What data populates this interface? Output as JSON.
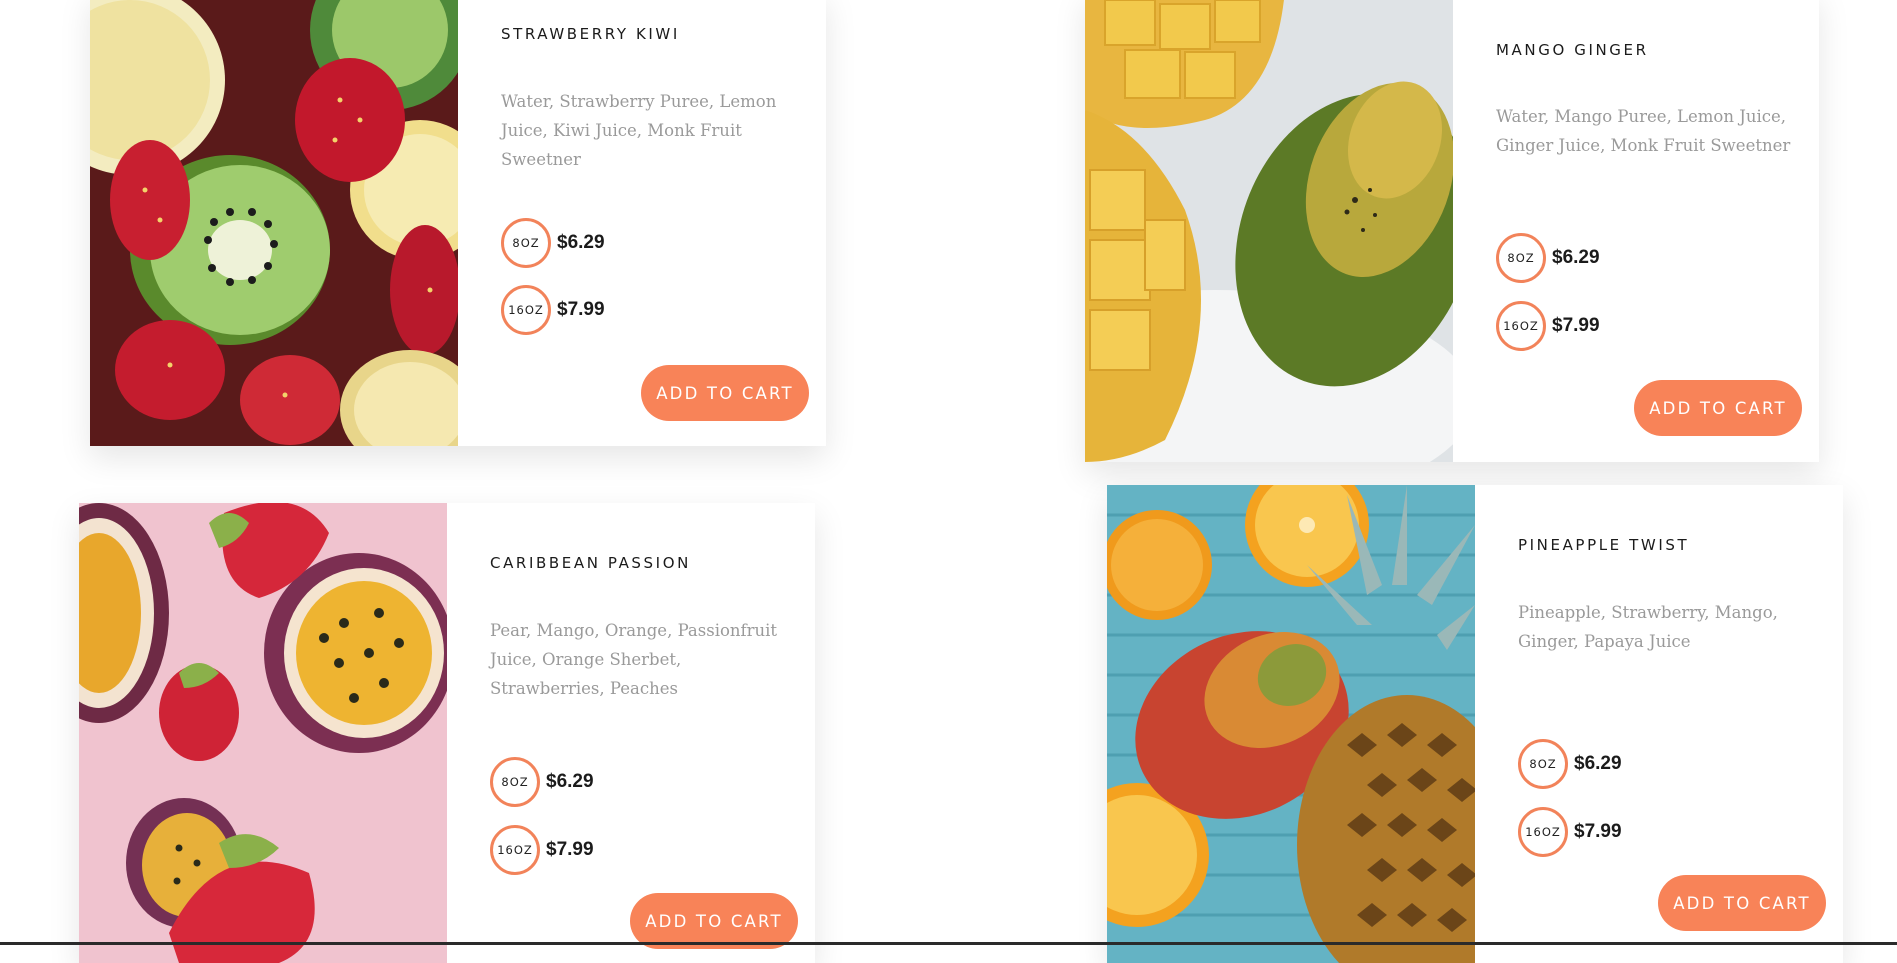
{
  "products": [
    {
      "name": "STRAWBERRY KIWI",
      "ingredients": "Water, Strawberry Puree, Lemon Juice, Kiwi Juice, Monk Fruit Sweetner",
      "sizes": [
        {
          "size": "8OZ",
          "price": "$6.29"
        },
        {
          "size": "16OZ",
          "price": "$7.99"
        }
      ],
      "button": "ADD TO CART"
    },
    {
      "name": "MANGO GINGER",
      "ingredients": "Water, Mango Puree, Lemon Juice, Ginger Juice, Monk Fruit Sweetner",
      "sizes": [
        {
          "size": "8OZ",
          "price": "$6.29"
        },
        {
          "size": "16OZ",
          "price": "$7.99"
        }
      ],
      "button": "ADD TO CART"
    },
    {
      "name": "CARIBBEAN PASSION",
      "ingredients": "Pear, Mango, Orange, Passionfruit Juice, Orange Sherbet, Strawberries, Peaches",
      "sizes": [
        {
          "size": "8OZ",
          "price": "$6.29"
        },
        {
          "size": "16OZ",
          "price": "$7.99"
        }
      ],
      "button": "ADD TO CART"
    },
    {
      "name": "PINEAPPLE TWIST",
      "ingredients": "Pineapple, Strawberry, Mango, Ginger, Papaya Juice",
      "sizes": [
        {
          "size": "8OZ",
          "price": "$6.29"
        },
        {
          "size": "16OZ",
          "price": "$7.99"
        }
      ],
      "button": "ADD TO CART"
    }
  ],
  "colors": {
    "accent": "#f88358",
    "ring": "#f2835a",
    "title": "#1b1b1b",
    "description": "#9a9a9a"
  }
}
